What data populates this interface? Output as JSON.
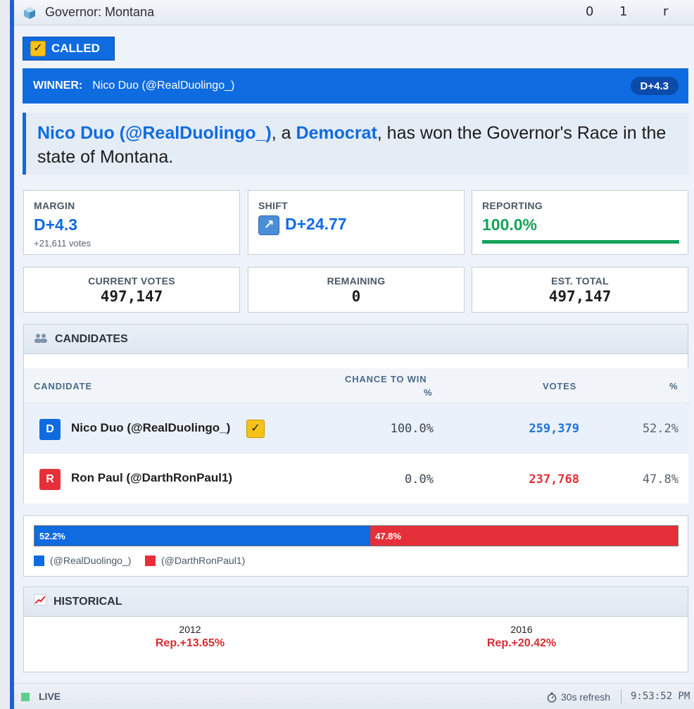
{
  "window": {
    "title": "Governor: Montana",
    "controls": [
      "0",
      "1",
      "r"
    ]
  },
  "called": {
    "label": "CALLED",
    "check": "✓"
  },
  "winner": {
    "label": "WINNER:",
    "name": "Nico Duo (@RealDuolingo_)",
    "margin_pill": "D+4.3"
  },
  "statement": {
    "name": "Nico Duo (@RealDuolingo_)",
    "sep": ", a ",
    "party": "Democrat",
    "rest": ", has won the Governor's Race in the state of Montana."
  },
  "stats": {
    "margin": {
      "caption": "MARGIN",
      "value": "D+4.3",
      "sub": "+21,611 votes"
    },
    "shift": {
      "caption": "SHIFT",
      "value": "D+24.77",
      "icon": "arrow-up-right-icon"
    },
    "reporting": {
      "caption": "REPORTING",
      "value": "100.0%",
      "progress": 1.0
    }
  },
  "counts": {
    "current": {
      "caption": "CURRENT VOTES",
      "value": "497,147"
    },
    "remaining": {
      "caption": "REMAINING",
      "value": "0"
    },
    "est_total": {
      "caption": "EST. TOTAL",
      "value": "497,147"
    }
  },
  "candidates": {
    "heading": "CANDIDATES",
    "columns": {
      "candidate": "CANDIDATE",
      "chance_line1": "CHANCE TO WIN",
      "chance_line2": "%",
      "votes": "VOTES",
      "pct": "%"
    },
    "rows": [
      {
        "party": "D",
        "name": "Nico Duo (@RealDuolingo_)",
        "chance": "100.0%",
        "votes": "259,379",
        "pct": "52.2%",
        "winner": true
      },
      {
        "party": "R",
        "name": "Ron Paul (@DarthRonPaul1)",
        "chance": "0.0%",
        "votes": "237,768",
        "pct": "47.8%",
        "winner": false
      }
    ]
  },
  "share_bar": {
    "dem_share": 52.2,
    "rep_share": 47.8,
    "dem_label": "52.2%",
    "rep_label": "47.8%",
    "legend": [
      "(@RealDuolingo_)",
      "(@DarthRonPaul1)"
    ]
  },
  "historical": {
    "heading": "HISTORICAL",
    "entries": [
      {
        "year": "2012",
        "value": "Rep.+13.65%"
      },
      {
        "year": "2016",
        "value": "Rep.+20.42%"
      }
    ]
  },
  "status": {
    "live": "LIVE",
    "refresh": "30s refresh",
    "clock": "9:53:52 PM"
  },
  "colors": {
    "dem": "#0f6be0",
    "rep": "#e5303a",
    "good": "#12a35a"
  }
}
